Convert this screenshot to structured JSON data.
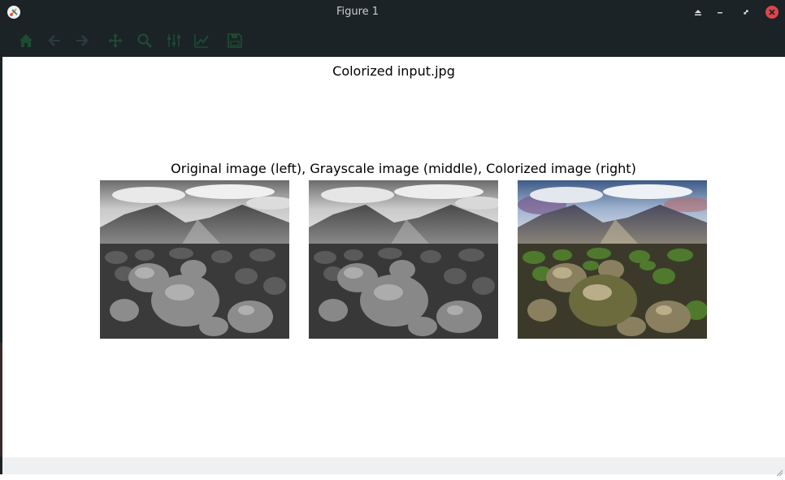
{
  "window": {
    "title": "Figure 1",
    "controls": [
      "eject-icon",
      "minimize-icon",
      "restore-icon",
      "close-icon"
    ]
  },
  "toolbar": {
    "items": [
      {
        "name": "home",
        "icon": "home-icon"
      },
      {
        "name": "back",
        "icon": "arrow-left-icon"
      },
      {
        "name": "forward",
        "icon": "arrow-right-icon"
      },
      {
        "name": "pan",
        "icon": "move-icon"
      },
      {
        "name": "zoom",
        "icon": "magnifier-icon"
      },
      {
        "name": "subplots",
        "icon": "sliders-icon"
      },
      {
        "name": "customize",
        "icon": "line-chart-icon"
      },
      {
        "name": "save",
        "icon": "floppy-icon"
      }
    ],
    "icon_color": "#1d4a33"
  },
  "figure": {
    "suptitle": "Colorized input.jpg",
    "axes_title": "Original image (left), Grayscale image (middle), Colorized image (right)",
    "panels": [
      "original",
      "grayscale",
      "colorized"
    ]
  },
  "colors": {
    "chrome": "#1b2326",
    "close": "#e0454b",
    "canvas": "#ffffff"
  }
}
